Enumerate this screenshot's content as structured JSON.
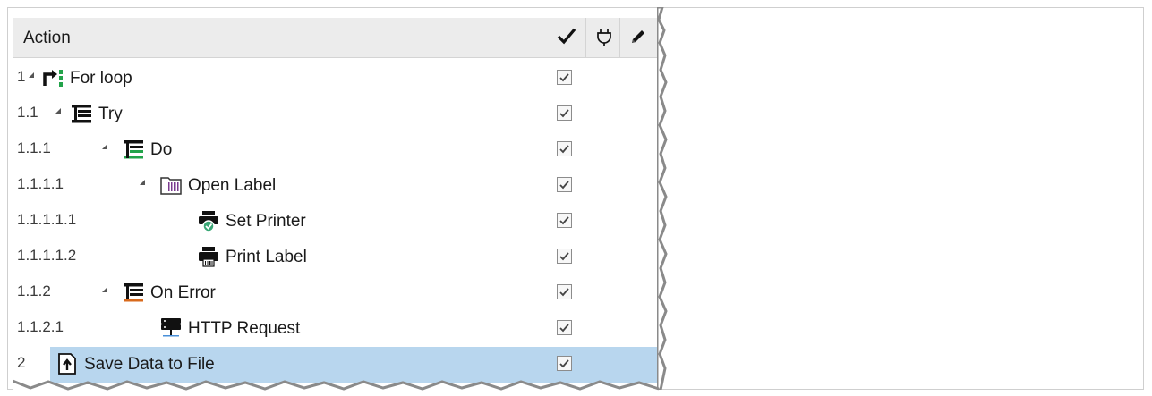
{
  "header": {
    "title": "Action",
    "columns": [
      {
        "name": "enabled-column",
        "icon": "checkmark-icon"
      },
      {
        "name": "breakpoint-column",
        "icon": "plug-icon"
      },
      {
        "name": "edit-column",
        "icon": "pencil-icon"
      }
    ]
  },
  "rows": [
    {
      "num": "1",
      "label": "For loop",
      "icon": "for-loop-icon",
      "checked": true,
      "selected": false
    },
    {
      "num": "1.1",
      "label": "Try",
      "icon": "try-icon",
      "checked": true,
      "selected": false
    },
    {
      "num": "1.1.1",
      "label": "Do",
      "icon": "do-icon",
      "checked": true,
      "selected": false
    },
    {
      "num": "1.1.1.1",
      "label": "Open Label",
      "icon": "open-label-icon",
      "checked": true,
      "selected": false
    },
    {
      "num": "1.1.1.1.1",
      "label": "Set Printer",
      "icon": "set-printer-icon",
      "checked": true,
      "selected": false
    },
    {
      "num": "1.1.1.1.2",
      "label": "Print Label",
      "icon": "print-label-icon",
      "checked": true,
      "selected": false
    },
    {
      "num": "1.1.2",
      "label": "On Error",
      "icon": "on-error-icon",
      "checked": true,
      "selected": false
    },
    {
      "num": "1.1.2.1",
      "label": "HTTP Request",
      "icon": "http-request-icon",
      "checked": true,
      "selected": false
    },
    {
      "num": "2",
      "label": "Save Data to File",
      "icon": "save-data-icon",
      "checked": true,
      "selected": true
    }
  ],
  "colors": {
    "selection": "#b8d6ee",
    "header": "#ececec",
    "loop_green": "#22a34a",
    "do_green": "#22a34a",
    "error_orange": "#d86a1c",
    "label_purple": "#7b3a8f",
    "printer_check_green": "#3aa776"
  }
}
